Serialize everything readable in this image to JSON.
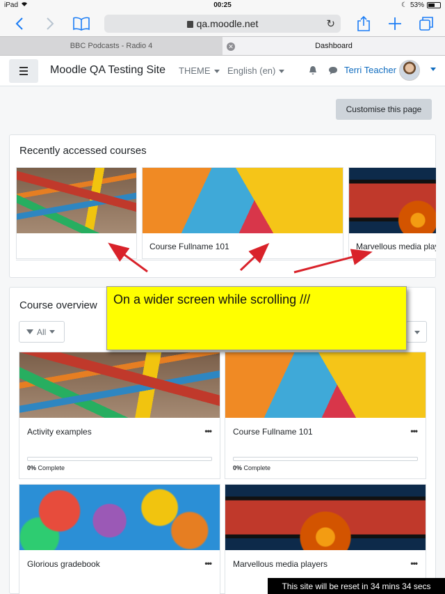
{
  "statusbar": {
    "device": "iPad",
    "time": "00:25",
    "battery": "53%"
  },
  "browser": {
    "url": "qa.moodle.net",
    "tabs": [
      {
        "label": "BBC Podcasts - Radio 4",
        "active": false
      },
      {
        "label": "Dashboard",
        "active": true
      }
    ]
  },
  "navbar": {
    "site_name": "Moodle QA Testing Site",
    "theme_label": "THEME",
    "language_label": "English (en)",
    "user_name": "Terri Teacher"
  },
  "page": {
    "customise_label": "Customise this page"
  },
  "recent": {
    "title": "Recently accessed courses",
    "courses": [
      {
        "name": "",
        "image": "toy-blocks"
      },
      {
        "name": "Course Fullname 101",
        "image": "notebook-markers"
      },
      {
        "name": "Marvellous media players",
        "image": "film-strip"
      }
    ]
  },
  "overview": {
    "title": "Course overview",
    "filter_label": "All",
    "courses": [
      {
        "name": "Activity examples",
        "progress_percent": 0,
        "percent_label": "0%",
        "complete_label": "Complete",
        "image": "toy-blocks"
      },
      {
        "name": "Course Fullname 101",
        "progress_percent": 0,
        "percent_label": "0%",
        "complete_label": "Complete",
        "image": "notebook-markers"
      },
      {
        "name": "Glorious gradebook",
        "image": "number-monsters"
      },
      {
        "name": "Marvellous media players",
        "image": "film-strip"
      }
    ],
    "more_label": "•••"
  },
  "annotation": {
    "text": "On a wider screen while scrolling ///",
    "color": "#ffff00",
    "arrow_color": "#d9222a"
  },
  "reset_banner": "This site will be reset in 34 mins 34 secs",
  "colors": {
    "accent": "#0f6cbf"
  }
}
